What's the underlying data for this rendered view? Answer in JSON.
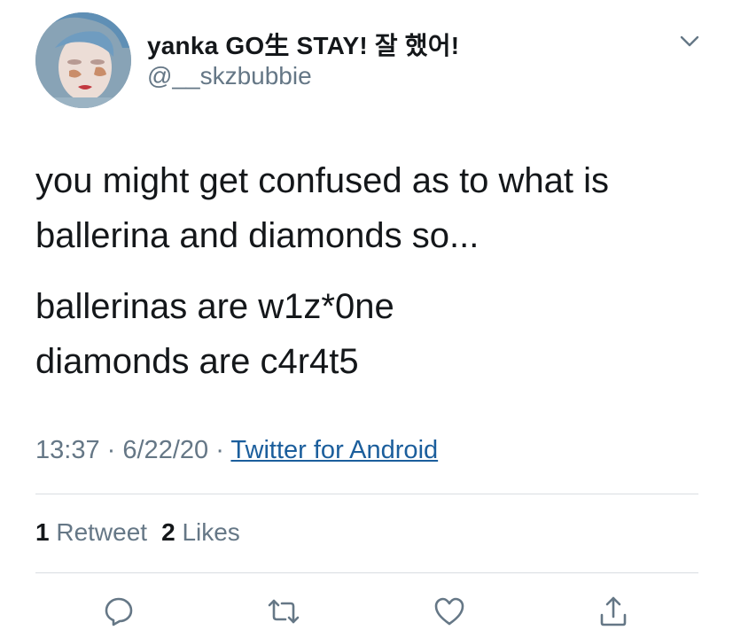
{
  "tweet": {
    "display_name": "yanka GO生 STAY! 잘 했어!",
    "handle": "@__skzbubbie",
    "text_lines": [
      "you might get confused as to what is",
      "ballerina and diamonds so...",
      "ballerinas are w1z*0ne",
      "diamonds are c4r4t5"
    ],
    "time": "13:37",
    "date": "6/22/20",
    "separator": "·",
    "source": "Twitter for Android",
    "retweet_count": "1",
    "retweet_label": "Retweet",
    "like_count": "2",
    "like_label": "Likes"
  },
  "icons": {
    "menu": "chevron-down-icon",
    "reply": "reply-icon",
    "retweet": "retweet-icon",
    "like": "heart-icon",
    "share": "share-icon"
  },
  "colors": {
    "text": "#14171a",
    "secondary": "#657786",
    "link": "#1b5e9c",
    "divider": "#d9dde1"
  }
}
